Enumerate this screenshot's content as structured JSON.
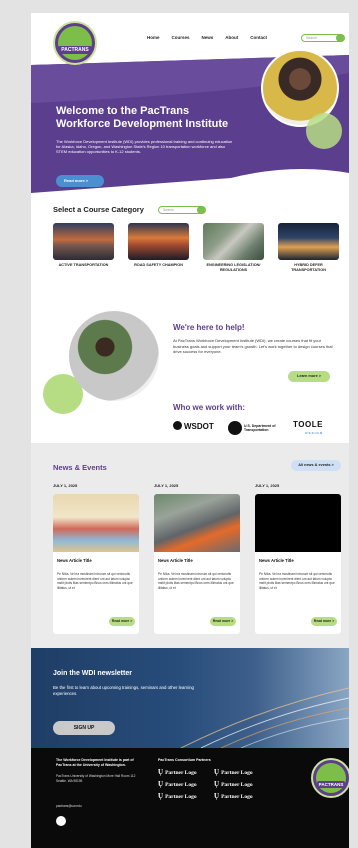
{
  "nav": {
    "links": [
      "Home",
      "Courses",
      "News",
      "About",
      "Contact"
    ],
    "search_placeholder": "Search"
  },
  "logo": {
    "text": "PACTRANS"
  },
  "hero": {
    "title": "Welcome to the PacTrans Workforce Development Institute",
    "description": "The Workforce Development Institute (WDI) provides professional training and continuing education for Alaska, Idaho, Oregon, and Washington State's Region 10 transportation workforce and also STEM education opportunities to K-12 students.",
    "button": "Read more >"
  },
  "categories": {
    "title": "Select a Course Category",
    "search_placeholder": "Search",
    "items": [
      "ACTIVE TRANSPORTATION",
      "ROAD SAFETY CHAMPION",
      "ENGINEERING LEGISLATION/ REGULATIONS",
      "HYBRID DEFER TRANSPORTATION"
    ]
  },
  "help": {
    "title": "We're here to help!",
    "text": "At PacTrans Workforce Development Institute (WDI), we create courses that fit your business goals and support your team's growth. Let's work together to design courses that drive success for everyone.",
    "button": "Learn more >"
  },
  "who": {
    "title": "Who we work with:",
    "partners": {
      "wsdot": "WSDOT",
      "usdot": "U.S. Department of Transportation",
      "toole": "TOOLE",
      "toole_sub": "DESIGN"
    }
  },
  "news": {
    "title": "News & Events",
    "all_button": "All news & events >",
    "items": [
      {
        "date": "JULY 1, 2025",
        "title": "News Article Title",
        "body": "Pe Niba. Vel ea mostinam introrum sit qui verionotis unform autem invenirent dient unt aut latum volupta mstit plotis litas sementpo Bnus ores illimatus unt que illitatus, ut et",
        "button": "Read more >"
      },
      {
        "date": "JULY 1, 2025",
        "title": "News Article Title",
        "body": "Pe Niba. Vel ea mostinam introrum sit qui verionotis unform autem invenirent dient unt aut latum volupta mstit plotis litas sementpo Bnus ores illimatus unt que illitatus, ut et",
        "button": "Read more >"
      },
      {
        "date": "JULY 1, 2025",
        "title": "News Article Title",
        "body": "Pe Niba. Vel ea mostinam introrum sit qui verionotis unform autem invenirent dient unt aut latum volupta mstit plotis litas sementpo Bnus ores illimatus unt que illitatus, ut et",
        "button": "Read more >"
      }
    ]
  },
  "newsletter": {
    "title": "Join the WDI newsletter",
    "text": "Be the first to learn about upcoming trainings, seminars and other learning experiences.",
    "button": "SIGN UP"
  },
  "footer": {
    "about": "The Workforce Development Institute is part of PacTrans at the University of Washington.",
    "address": "PacTrans University of Washington More Hall Room 112 Seattle, WA 98195",
    "email": "pactrans@uw.edu",
    "partners_title": "PacTrans Consortium Partners",
    "partner_logos": [
      "Partner Logo",
      "Partner Logo",
      "Partner Logo",
      "Partner Logo",
      "Partner Logo",
      "Partner Logo"
    ],
    "badge_text": "PACTRANS"
  },
  "colors": {
    "purple": "#5e3e8c",
    "green": "#7dbd4a",
    "light_green": "#b7dd84",
    "blue": "#4b8fd0",
    "navy": "#1f3e66"
  },
  "icons": [
    "search-icon",
    "social-icon",
    "wsdot-mark-icon",
    "usdot-seal-icon"
  ]
}
